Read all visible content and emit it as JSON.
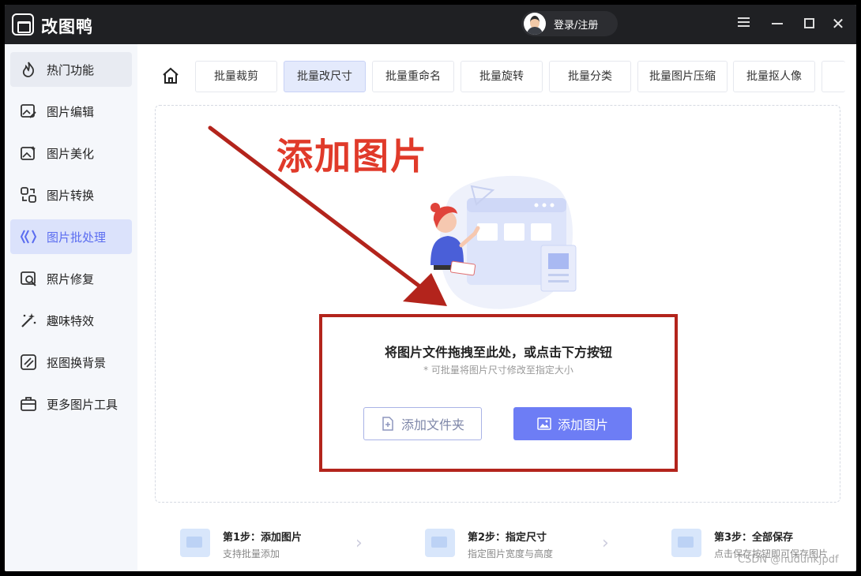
{
  "app": {
    "title": "改图鸭",
    "login_label": "登录/注册"
  },
  "sidebar": {
    "items": [
      {
        "label": "热门功能",
        "icon": "flame-icon"
      },
      {
        "label": "图片编辑",
        "icon": "image-edit-icon"
      },
      {
        "label": "图片美化",
        "icon": "image-beautify-icon"
      },
      {
        "label": "图片转换",
        "icon": "image-convert-icon"
      },
      {
        "label": "图片批处理",
        "icon": "batch-icon"
      },
      {
        "label": "照片修复",
        "icon": "photo-repair-icon"
      },
      {
        "label": "趣味特效",
        "icon": "magic-wand-icon"
      },
      {
        "label": "抠图换背景",
        "icon": "cutout-icon"
      },
      {
        "label": "更多图片工具",
        "icon": "toolbox-icon"
      }
    ],
    "active_index": 4
  },
  "tabs": [
    {
      "label": "批量裁剪"
    },
    {
      "label": "批量改尺寸"
    },
    {
      "label": "批量重命名"
    },
    {
      "label": "批量旋转"
    },
    {
      "label": "批量分类"
    },
    {
      "label": "批量图片压缩"
    },
    {
      "label": "批量抠人像"
    }
  ],
  "active_tab": 1,
  "annotation": {
    "headline": "添加图片"
  },
  "dropzone": {
    "main_text": "将图片文件拖拽至此处，或点击下方按钮",
    "sub_text": "* 可批量将图片尺寸修改至指定大小",
    "add_folder_label": "添加文件夹",
    "add_image_label": "添加图片"
  },
  "steps": [
    {
      "title": "第1步：添加图片",
      "desc": "支持批量添加"
    },
    {
      "title": "第2步：指定尺寸",
      "desc": "指定图片宽度与高度"
    },
    {
      "title": "第3步：全部保存",
      "desc": "点击保存按钮即可保存图片"
    }
  ],
  "watermark": "CSDN @hudunkjpdf",
  "colors": {
    "accent": "#6d7df5",
    "annotation_red": "#b3241c",
    "titlebar": "#1f2023"
  }
}
